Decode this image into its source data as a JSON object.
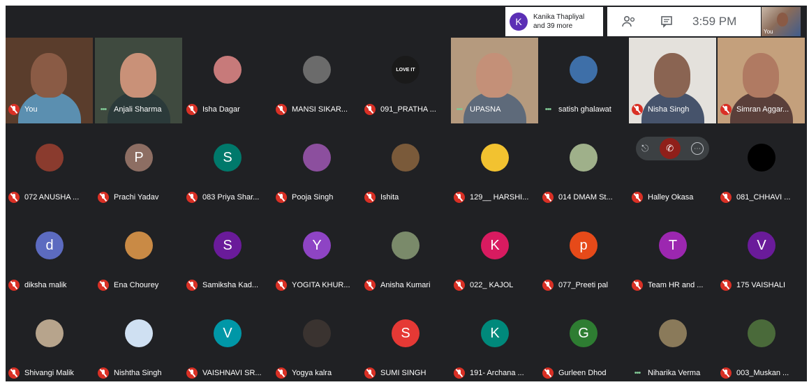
{
  "top_bar": {
    "participants_chip": {
      "avatar_letter": "K",
      "line1": "Kanika Thapliyal",
      "line2": "and 39 more"
    },
    "people_icon": "people-icon",
    "chat_icon": "chat-icon",
    "time": "3:59 PM",
    "self_view_label": "You"
  },
  "tiles": [
    {
      "name": "You",
      "kind": "video",
      "status": "muted"
    },
    {
      "name": "Anjali Sharma",
      "kind": "video",
      "status": "talking"
    },
    {
      "name": "Isha Dagar",
      "kind": "photo",
      "status": "muted",
      "color": "#c77a7a"
    },
    {
      "name": "MANSI SIKAR...",
      "kind": "photo",
      "status": "muted",
      "color": "#6b6b6b"
    },
    {
      "name": "091_PRATHA ...",
      "kind": "text-avatar",
      "status": "muted",
      "avatar_text": "LOVE IT",
      "color": "#1a1a1a"
    },
    {
      "name": "UPASNA",
      "kind": "video",
      "status": "talking"
    },
    {
      "name": "satish ghalawat",
      "kind": "photo",
      "status": "talking",
      "color": "#3e6fa8"
    },
    {
      "name": "Nisha Singh",
      "kind": "video",
      "status": "muted"
    },
    {
      "name": "Simran Aggar...",
      "kind": "video",
      "status": "muted"
    },
    {
      "name": "072 ANUSHA ...",
      "kind": "photo",
      "status": "muted",
      "color": "#8a3b2e"
    },
    {
      "name": "Prachi Yadav",
      "kind": "letter",
      "status": "muted",
      "letter": "P",
      "color": "#8d6e63"
    },
    {
      "name": "083 Priya Shar...",
      "kind": "letter",
      "status": "muted",
      "letter": "S",
      "color": "#00796b"
    },
    {
      "name": "Pooja Singh",
      "kind": "photo",
      "status": "muted",
      "color": "#8c4f9e"
    },
    {
      "name": "Ishita",
      "kind": "photo",
      "status": "muted",
      "color": "#7a5a3a"
    },
    {
      "name": "129__ HARSHI...",
      "kind": "photo",
      "status": "muted",
      "color": "#f2c230"
    },
    {
      "name": "014 DMAM St...",
      "kind": "photo",
      "status": "muted",
      "color": "#9fb08a"
    },
    {
      "name": "Halley Okasa",
      "kind": "hover",
      "status": "muted"
    },
    {
      "name": "081_CHHAVI ...",
      "kind": "photo",
      "status": "muted",
      "color": "#000000"
    },
    {
      "name": "diksha malik",
      "kind": "letter",
      "status": "muted",
      "letter": "d",
      "color": "#5c6bc0"
    },
    {
      "name": "Ena Chourey",
      "kind": "photo",
      "status": "muted",
      "color": "#c98a45"
    },
    {
      "name": "Samiksha Kad...",
      "kind": "letter",
      "status": "muted",
      "letter": "S",
      "color": "#6a1b9a"
    },
    {
      "name": "YOGITA KHUR...",
      "kind": "letter",
      "status": "muted",
      "letter": "Y",
      "color": "#8e44c4"
    },
    {
      "name": "Anisha Kumari",
      "kind": "photo",
      "status": "muted",
      "color": "#7a8a6a"
    },
    {
      "name": "022_ KAJOL",
      "kind": "letter",
      "status": "muted",
      "letter": "K",
      "color": "#d81b60"
    },
    {
      "name": "077_Preeti pal",
      "kind": "letter",
      "status": "muted",
      "letter": "p",
      "color": "#e64a19"
    },
    {
      "name": "Team HR and ...",
      "kind": "letter",
      "status": "muted",
      "letter": "T",
      "color": "#9c27b0"
    },
    {
      "name": "175 VAISHALI",
      "kind": "letter",
      "status": "muted",
      "letter": "V",
      "color": "#6a1b9a"
    },
    {
      "name": "Shivangi Malik",
      "kind": "photo",
      "status": "muted",
      "color": "#b7a48c"
    },
    {
      "name": "Nishtha Singh",
      "kind": "photo",
      "status": "muted",
      "color": "#cfe0f2"
    },
    {
      "name": "VAISHNAVI SR...",
      "kind": "letter",
      "status": "muted",
      "letter": "V",
      "color": "#0097a7"
    },
    {
      "name": "Yogya kalra",
      "kind": "photo",
      "status": "muted",
      "color": "#3a3330"
    },
    {
      "name": "SUMI SINGH",
      "kind": "letter",
      "status": "muted",
      "letter": "S",
      "color": "#e53935"
    },
    {
      "name": "191- Archana ...",
      "kind": "letter",
      "status": "muted",
      "letter": "K",
      "color": "#00897b"
    },
    {
      "name": "Gurleen Dhod",
      "kind": "letter",
      "status": "muted",
      "letter": "G",
      "color": "#2e7d32"
    },
    {
      "name": "Niharika Verma",
      "kind": "photo",
      "status": "talking",
      "color": "#8a7a5a"
    },
    {
      "name": "003_Muskan ...",
      "kind": "photo",
      "status": "muted",
      "color": "#4a6a3a"
    }
  ],
  "video_palettes": [
    {
      "bg": "#5a3d2c",
      "skin": "#8a5b45",
      "shirt": "#5b8fb0"
    },
    {
      "bg": "#3f4a3f",
      "skin": "#c99178",
      "shirt": "#2b3a3a"
    },
    {
      "bg": "#b59a7e",
      "skin": "#c49078",
      "shirt": "#5e6a7a"
    },
    {
      "bg": "#e4e1dc",
      "skin": "#8a6452",
      "shirt": "#46536b"
    },
    {
      "bg": "#c4a07c",
      "skin": "#b07a62",
      "shirt": "#5a3f3a"
    }
  ]
}
